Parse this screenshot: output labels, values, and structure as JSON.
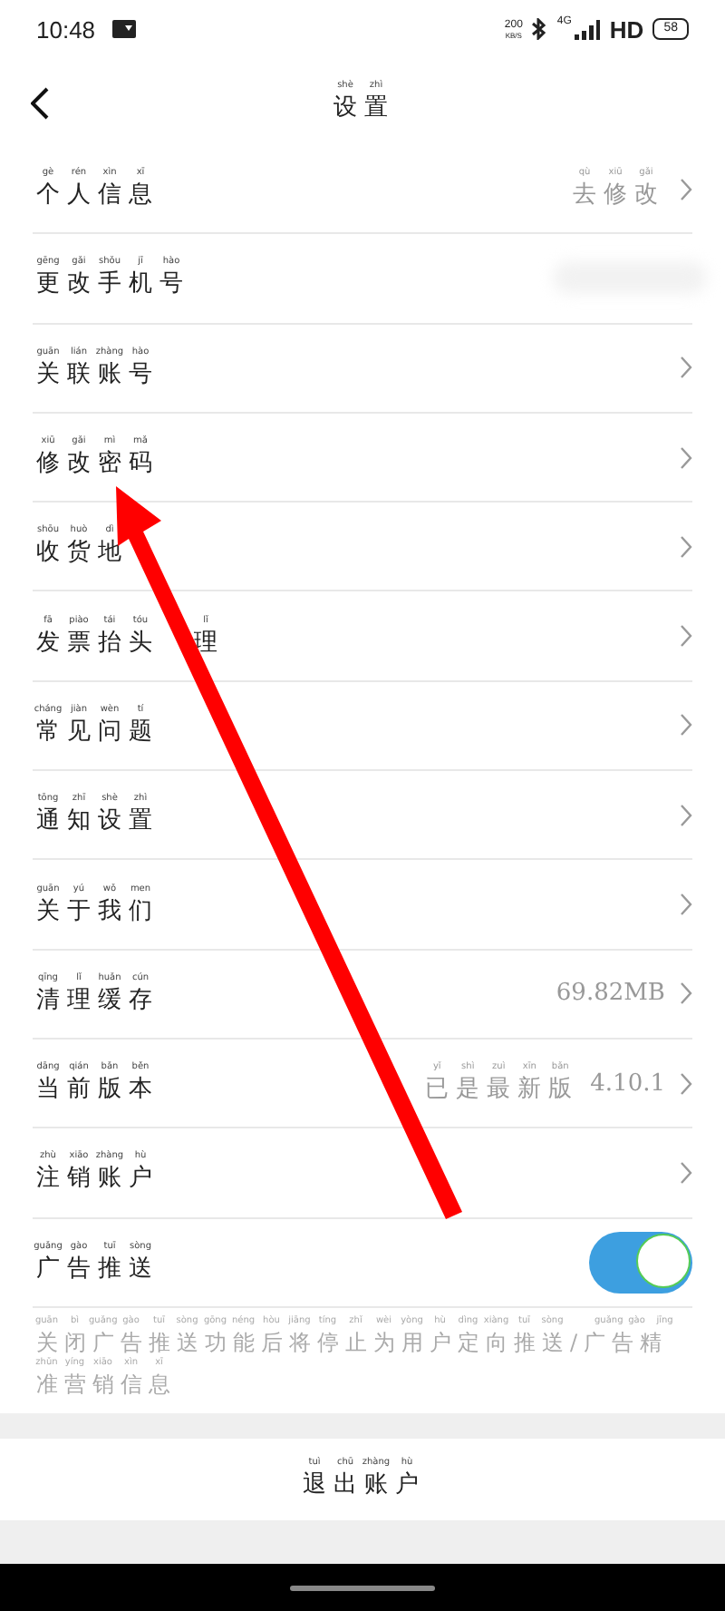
{
  "status_bar": {
    "time": "10:48",
    "speed": "200",
    "speed_unit": "KB/S",
    "network": "4G",
    "hd": "HD",
    "battery": "58"
  },
  "header": {
    "title": {
      "text": "设置",
      "pinyin": "shè zhì"
    }
  },
  "rows": [
    {
      "kind": "link",
      "label": {
        "text": "个人信息",
        "pinyin": "gè rén xìn xī"
      },
      "value": {
        "text": "去修改",
        "pinyin": "qù xiū gǎi"
      }
    },
    {
      "kind": "blurred",
      "label": {
        "text": "更改手机号",
        "pinyin": "gēng gǎi shǒu jī hào"
      }
    },
    {
      "kind": "link",
      "label": {
        "text": "关联账号",
        "pinyin": "guān lián zhàng hào"
      }
    },
    {
      "kind": "link",
      "label": {
        "text": "修改密码",
        "pinyin": "xiū gǎi mì mǎ"
      }
    },
    {
      "kind": "link",
      "label": {
        "text": "收货地",
        "pinyin": "shōu huò dì"
      }
    },
    {
      "kind": "link",
      "label": {
        "text": "发票抬头",
        "pinyin": "fā piào tái tóu"
      },
      "label_tail": {
        "text": "理",
        "pinyin": "lǐ"
      }
    },
    {
      "kind": "link",
      "label": {
        "text": "常见问题",
        "pinyin": "cháng jiàn wèn tí"
      }
    },
    {
      "kind": "link",
      "label": {
        "text": "通知设置",
        "pinyin": "tōng zhī shè zhì"
      }
    },
    {
      "kind": "link",
      "label": {
        "text": "关于我们",
        "pinyin": "guān yú wǒ men"
      }
    },
    {
      "kind": "link",
      "label": {
        "text": "清理缓存",
        "pinyin": "qīng lǐ huǎn cún"
      },
      "extra": "69.82MB"
    },
    {
      "kind": "link",
      "label": {
        "text": "当前版本",
        "pinyin": "dāng qián bǎn běn"
      },
      "value": {
        "text": "已是最新版",
        "pinyin": "yǐ shì zuì xīn bǎn"
      },
      "extra": "4.10.1"
    },
    {
      "kind": "link",
      "label": {
        "text": "注销账户",
        "pinyin": "zhù xiāo zhàng hù"
      }
    },
    {
      "kind": "toggle",
      "label": {
        "text": "广告推送",
        "pinyin": "guǎng gào tuī sòng"
      },
      "on": true
    }
  ],
  "note": {
    "lines": [
      {
        "text": "关闭广告推送功能后将停止为用户定向推送/广告精",
        "pinyin": "guān bì guǎng gào tuī sòng gōng néng hòu jiāng tíng zhǐ wèi yòng hù dìng xiàng tuī sòng guǎng gào jīng"
      },
      {
        "text": "准营销信息",
        "pinyin": "zhǔn yíng xiāo xìn xī"
      }
    ]
  },
  "logout": {
    "text": "退出账户",
    "pinyin": "tuì chū zhàng hù"
  }
}
